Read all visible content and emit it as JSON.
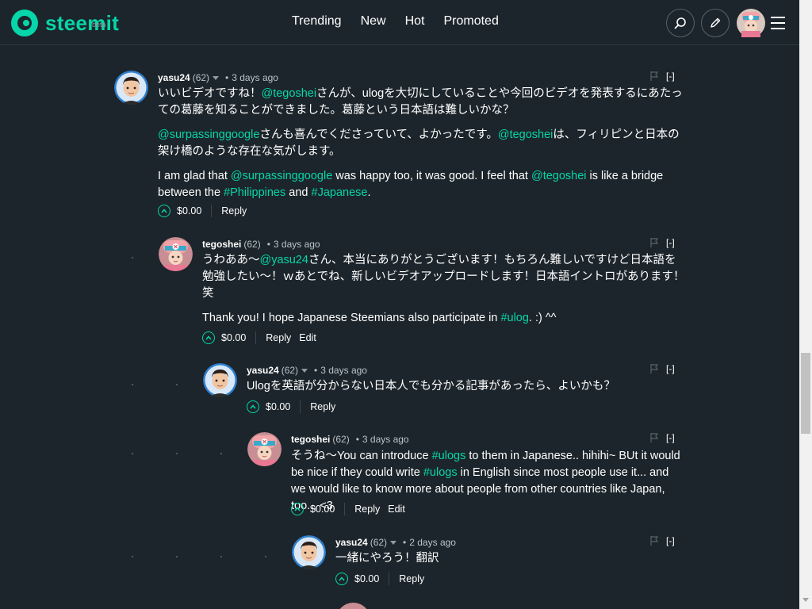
{
  "header": {
    "logo_text": "steemit",
    "beta_label": "beta",
    "nav": [
      "Trending",
      "New",
      "Hot",
      "Promoted"
    ],
    "search_icon": "search-icon",
    "compose_icon": "pencil-icon",
    "menu_icon": "hamburger-icon"
  },
  "comments": [
    {
      "author": "yasu24",
      "rep": "(62)",
      "time": "3 days ago",
      "body": [
        [
          {
            "t": "いいビデオですね！"
          },
          {
            "l": "@tegoshei"
          },
          {
            "t": "さんが、ulogを大切にしていることや今回のビデオを発表するにあたっての葛藤を知ることができました。葛藤という日本語は難しいかな？"
          }
        ],
        [
          {
            "l": "@surpassinggoogle"
          },
          {
            "t": "さんも喜んでくださっていて、よかったです。"
          },
          {
            "l": "@tegoshei"
          },
          {
            "t": "は、フィリピンと日本の架け橋のような存在な気がします。"
          }
        ],
        [
          {
            "t": "I am glad that "
          },
          {
            "l": "@surpassinggoogle"
          },
          {
            "t": " was happy too, it was good. I feel that "
          },
          {
            "l": "@tegoshei"
          },
          {
            "t": " is like a bridge between the "
          },
          {
            "l": "#Philippines"
          },
          {
            "t": " and "
          },
          {
            "l": "#Japanese"
          },
          {
            "t": "."
          }
        ]
      ],
      "payout": "$0.00",
      "actions": [
        "Reply"
      ],
      "collapse": "[-]"
    },
    {
      "author": "tegoshei",
      "rep": "(62)",
      "time": "3 days ago",
      "body": [
        [
          {
            "t": "うわああ〜"
          },
          {
            "l": "@yasu24"
          },
          {
            "t": "さん、本当にありがとうございます！もちろん難しいですけど日本語を勉強したい〜！ｗあとでね、新しいビデオアップロードします！日本語イントロがあります！笑"
          }
        ],
        [
          {
            "t": "Thank you! I hope Japanese Steemians also participate in "
          },
          {
            "l": "#ulog"
          },
          {
            "t": ". :) ^^"
          }
        ]
      ],
      "payout": "$0.00",
      "actions": [
        "Reply",
        "Edit"
      ],
      "collapse": "[-]"
    },
    {
      "author": "yasu24",
      "rep": "(62)",
      "time": "3 days ago",
      "body": [
        [
          {
            "t": "Ulogを英語が分からない日本人でも分かる記事があったら、よいかも？"
          }
        ]
      ],
      "payout": "$0.00",
      "actions": [
        "Reply"
      ],
      "collapse": "[-]"
    },
    {
      "author": "tegoshei",
      "rep": "(62)",
      "time": "3 days ago",
      "body": [
        [
          {
            "t": "そうね〜You can introduce "
          },
          {
            "l": "#ulogs"
          },
          {
            "t": " to them in Japanese.. hihihi~ BUt it would be nice if they could write "
          },
          {
            "l": "#ulogs"
          },
          {
            "t": " in English since most people use it... and we would like to know more about people from other countries like Japan, too... <3"
          }
        ]
      ],
      "payout": "$0.00",
      "actions": [
        "Reply",
        "Edit"
      ],
      "collapse": "[-]"
    },
    {
      "author": "yasu24",
      "rep": "(62)",
      "time": "2 days ago",
      "body": [
        [
          {
            "t": "一緒にやろう！翻訳"
          }
        ]
      ],
      "payout": "$0.00",
      "actions": [
        "Reply"
      ],
      "collapse": "[-]"
    }
  ],
  "colors": {
    "background": "#1c252b",
    "accent": "#06d6a9",
    "muted": "#b8c3c9"
  }
}
